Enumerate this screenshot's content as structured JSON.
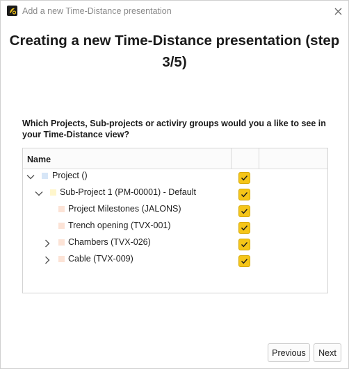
{
  "window": {
    "title": "Add a new Time-Distance presentation",
    "icons": {
      "app": "app-logo-icon",
      "close": "close-icon"
    }
  },
  "heading": "Creating a new Time-Distance presentation (step 3/5)",
  "question": "Which Projects, Sub-projects or activiry groups would you a like to see in your Time-Distance view?",
  "tree": {
    "columns": [
      "Name",
      "",
      ""
    ],
    "rows": [
      {
        "label": "Project ()",
        "expander": "chevron-down-icon",
        "checked": true,
        "swatch_color": "#d7e6f7"
      },
      {
        "label": "Sub-Project 1 (PM-00001) - Default",
        "expander": "chevron-down-icon",
        "checked": true,
        "swatch_color": "#fff6cc"
      },
      {
        "label": "Project Milestones (JALONS)",
        "expander": "",
        "checked": true,
        "swatch_color": "#fce3d6"
      },
      {
        "label": "Trench opening (TVX-001)",
        "expander": "",
        "checked": true,
        "swatch_color": "#fce3d6"
      },
      {
        "label": "Chambers (TVX-026)",
        "expander": "chevron-right-icon",
        "checked": true,
        "swatch_color": "#fce3d6"
      },
      {
        "label": "Cable (TVX-009)",
        "expander": "chevron-right-icon",
        "checked": true,
        "swatch_color": "#fce3d6"
      }
    ]
  },
  "buttons": {
    "previous": "Previous",
    "next": "Next"
  },
  "colors": {
    "checkbox": "#f5c518",
    "border": "#d3d3d3"
  }
}
